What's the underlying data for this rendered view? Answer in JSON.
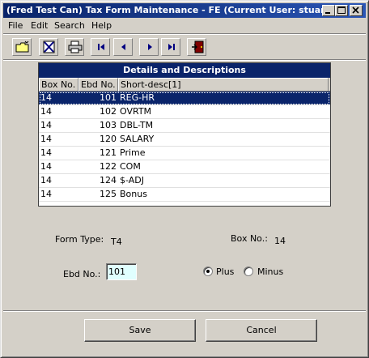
{
  "window": {
    "title": "(Fred Test Can) Tax Form Maintenance - FE (Current User: stuart)"
  },
  "menu": {
    "items": [
      {
        "label": "File",
        "accel": "F"
      },
      {
        "label": "Edit",
        "accel": "E"
      },
      {
        "label": "Search",
        "accel": "S"
      },
      {
        "label": "Help",
        "accel": "H"
      }
    ]
  },
  "toolbar": {
    "icons": [
      "open-folder-icon",
      "delete-x-icon",
      "print-icon",
      "first-record-icon",
      "previous-record-icon",
      "next-record-icon",
      "last-record-icon",
      "exit-door-icon"
    ]
  },
  "grid": {
    "caption": "Details and Descriptions",
    "columns": [
      "Box No.",
      "Ebd No.",
      "Short-desc[1]"
    ],
    "rows": [
      {
        "box": "14",
        "ebd": "101",
        "desc": "REG-HR",
        "selected": true
      },
      {
        "box": "14",
        "ebd": "102",
        "desc": "OVRTM"
      },
      {
        "box": "14",
        "ebd": "103",
        "desc": "DBL-TM"
      },
      {
        "box": "14",
        "ebd": "120",
        "desc": "SALARY"
      },
      {
        "box": "14",
        "ebd": "121",
        "desc": "Prime"
      },
      {
        "box": "14",
        "ebd": "122",
        "desc": "COM"
      },
      {
        "box": "14",
        "ebd": "124",
        "desc": "$-ADJ"
      },
      {
        "box": "14",
        "ebd": "125",
        "desc": "Bonus"
      }
    ]
  },
  "form": {
    "form_type_label": "Form Type:",
    "form_type_value": "T4",
    "box_no_label": "Box No.:",
    "box_no_value": "14",
    "ebd_no_label": "Ebd No.:",
    "ebd_no_value": "101",
    "plus_label": "Plus",
    "minus_label": "Minus",
    "selected_sign": "Plus"
  },
  "buttons": {
    "save": "Save",
    "cancel": "Cancel"
  },
  "colors": {
    "title_bar": "#0a246a",
    "selection": "#0a246a",
    "input_bg": "#e0ffff"
  }
}
